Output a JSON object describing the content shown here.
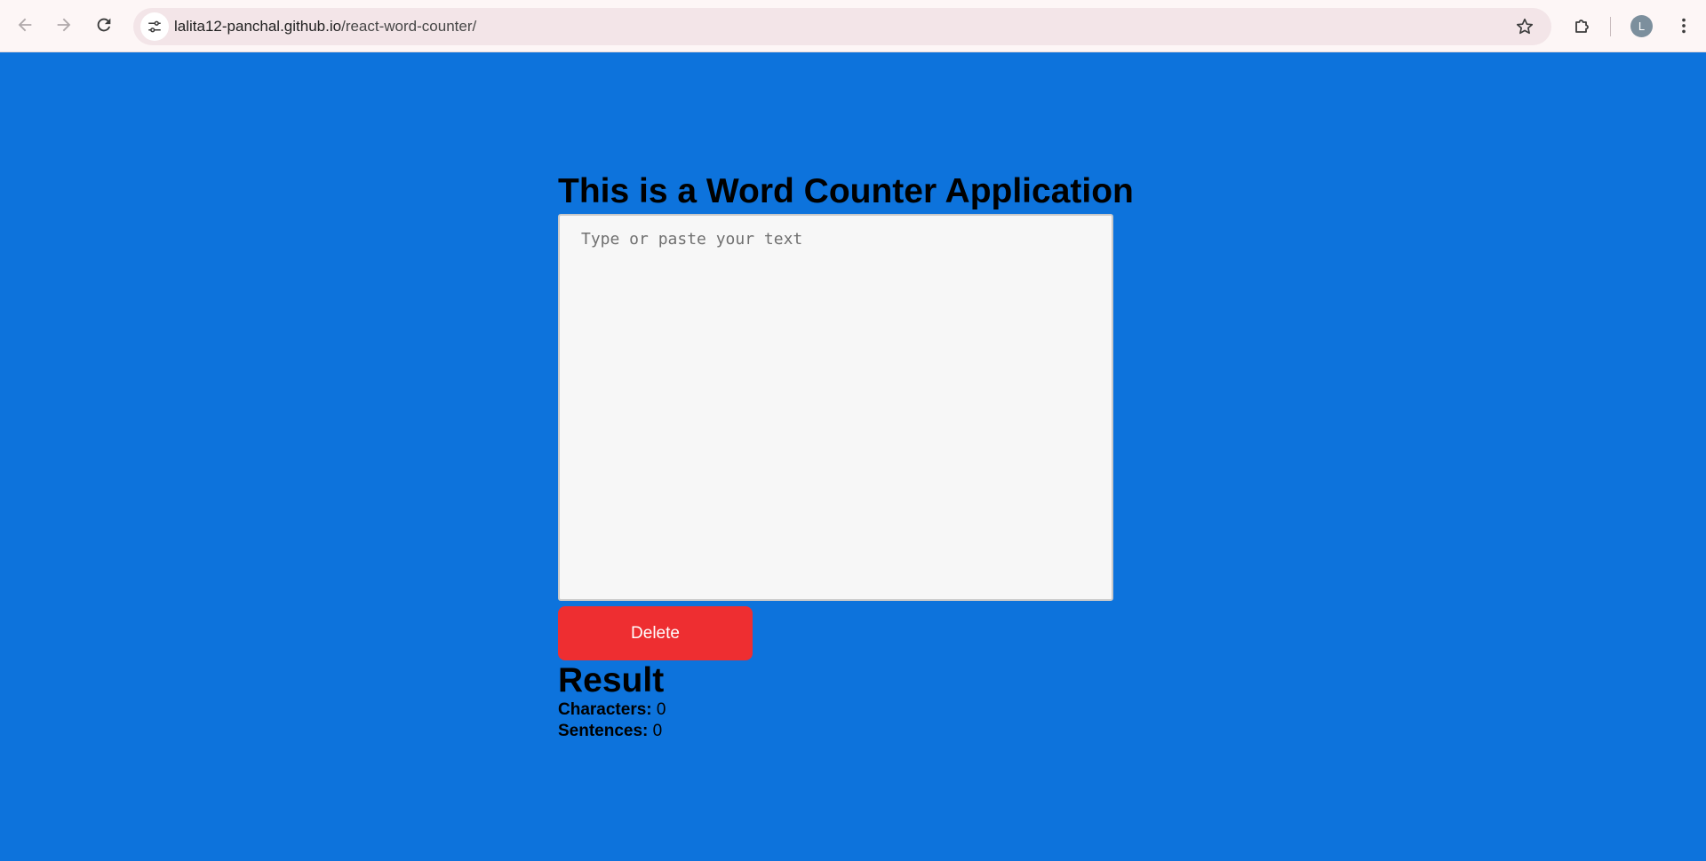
{
  "browser": {
    "url_domain": "lalita12-panchal.github.io",
    "url_path": "/react-word-counter/",
    "profile_initial": "L",
    "icons": {
      "back": "arrow-left-icon",
      "forward": "arrow-right-icon",
      "reload": "reload-icon",
      "site_info": "tune-icon",
      "bookmark": "star-icon",
      "extensions": "puzzle-icon",
      "menu": "kebab-menu-icon"
    }
  },
  "app": {
    "title": "This is a Word Counter Application",
    "textarea_placeholder": "Type or paste your text",
    "textarea_value": "",
    "delete_label": "Delete",
    "result_title": "Result",
    "characters_label": "Characters:",
    "characters_value": "0",
    "sentences_label": "Sentences:",
    "sentences_value": "0"
  },
  "colors": {
    "page_background": "#0d73dc",
    "delete_button": "#ee2e31",
    "textarea_background": "#f7f7f7"
  }
}
